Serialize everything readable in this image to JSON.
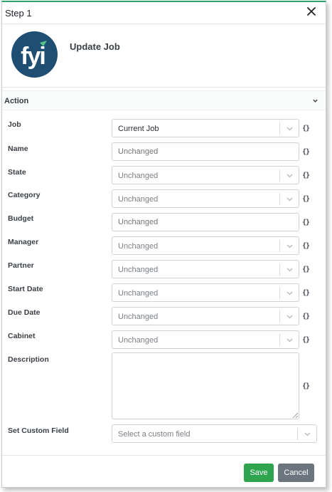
{
  "header": {
    "title": "Step 1",
    "close_icon": "close-icon"
  },
  "intro": {
    "title": "Update Job",
    "logo_text": "fyi",
    "logo_color": "#1f4e73",
    "logo_accent": "#58c48c"
  },
  "section": {
    "title": "Action",
    "chevron_icon": "chevron-down-icon"
  },
  "fields": {
    "job": {
      "label": "Job",
      "value": "Current Job"
    },
    "name": {
      "label": "Name",
      "placeholder": "Unchanged"
    },
    "state": {
      "label": "State",
      "value": "Unchanged"
    },
    "category": {
      "label": "Category",
      "value": "Unchanged"
    },
    "budget": {
      "label": "Budget",
      "placeholder": "Unchanged"
    },
    "manager": {
      "label": "Manager",
      "value": "Unchanged"
    },
    "partner": {
      "label": "Partner",
      "value": "Unchanged"
    },
    "start_date": {
      "label": "Start Date",
      "value": "Unchanged"
    },
    "due_date": {
      "label": "Due Date",
      "value": "Unchanged"
    },
    "cabinet": {
      "label": "Cabinet",
      "value": "Unchanged"
    },
    "description": {
      "label": "Description",
      "value": ""
    },
    "custom_field": {
      "label": "Set Custom Field",
      "placeholder": "Select a custom field"
    }
  },
  "variable_icon": "{}",
  "footer": {
    "save_label": "Save",
    "cancel_label": "Cancel"
  },
  "colors": {
    "accent_green": "#2ea44f",
    "top_border": "#2ea36a",
    "cancel_gray": "#6c757d"
  }
}
